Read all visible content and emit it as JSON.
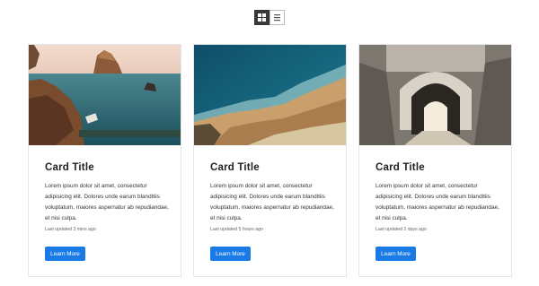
{
  "view_toggle": {
    "grid_icon": "grid-icon",
    "list_icon": "list-icon",
    "active": "grid"
  },
  "colors": {
    "button_bg": "#1a7ae6",
    "toggle_active": "#3a3a3a"
  },
  "cards": [
    {
      "image": "coastal-rocks-sea-photo",
      "title": "Card Title",
      "text": "Lorem ipsum dolor sit amet, consectetur adipisicing elit. Dolores unde earum blanditiis voluptatum, maiores aspernatur ab repudiandae, et nisi culpa.",
      "meta": "Last updated 3 mins ago",
      "button": "Learn More"
    },
    {
      "image": "aerial-ocean-cliff-photo",
      "title": "Card Title",
      "text": "Lorem ipsum dolor sit amet, consectetur adipisicing elit. Dolores unde earum blanditiis voluptatum, maiores aspernatur ab repudiandae, et nisi culpa.",
      "meta": "Last updated 5 hours ago",
      "button": "Learn More"
    },
    {
      "image": "stone-tunnel-photo",
      "title": "Card Title",
      "text": "Lorem ipsum dolor sit amet, consectetur adipisicing elit. Dolores unde earum blanditiis voluptatum, maiores aspernatur ab repudiandae, et nisi culpa.",
      "meta": "Last updated 2 days ago",
      "button": "Learn More"
    }
  ]
}
